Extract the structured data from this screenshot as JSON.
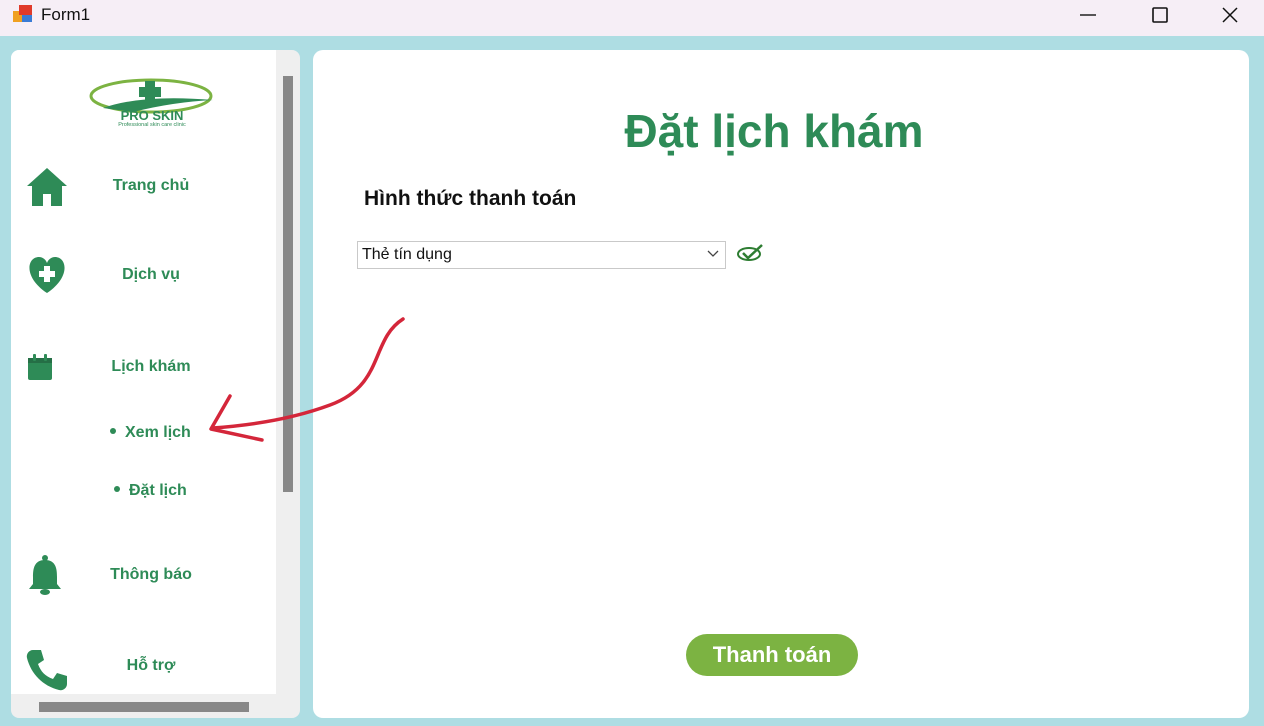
{
  "window": {
    "title": "Form1"
  },
  "sidebar": {
    "logo": {
      "brand": "PRO SKIN",
      "tagline": "Professional skin care clinic"
    },
    "items": [
      {
        "label": "Trang chủ",
        "icon": "home-icon"
      },
      {
        "label": "Dịch vụ",
        "icon": "heart-plus-icon"
      },
      {
        "label": "Lịch khám",
        "icon": "calendar-icon"
      },
      {
        "label": "Thông báo",
        "icon": "bell-icon"
      },
      {
        "label": "Hỗ trợ",
        "icon": "phone-icon"
      }
    ],
    "sub_items": [
      {
        "label": "Xem lịch"
      },
      {
        "label": "Đặt lịch"
      }
    ]
  },
  "main": {
    "title": "Đặt lịch khám",
    "payment_label": "Hình thức thanh toán",
    "payment_select": {
      "value": "Thẻ tín dụng"
    },
    "pay_button": "Thanh toán"
  },
  "colors": {
    "accent": "#2e8b57",
    "button": "#7cb342",
    "background": "#aedde3",
    "annotation": "#d4263a"
  }
}
